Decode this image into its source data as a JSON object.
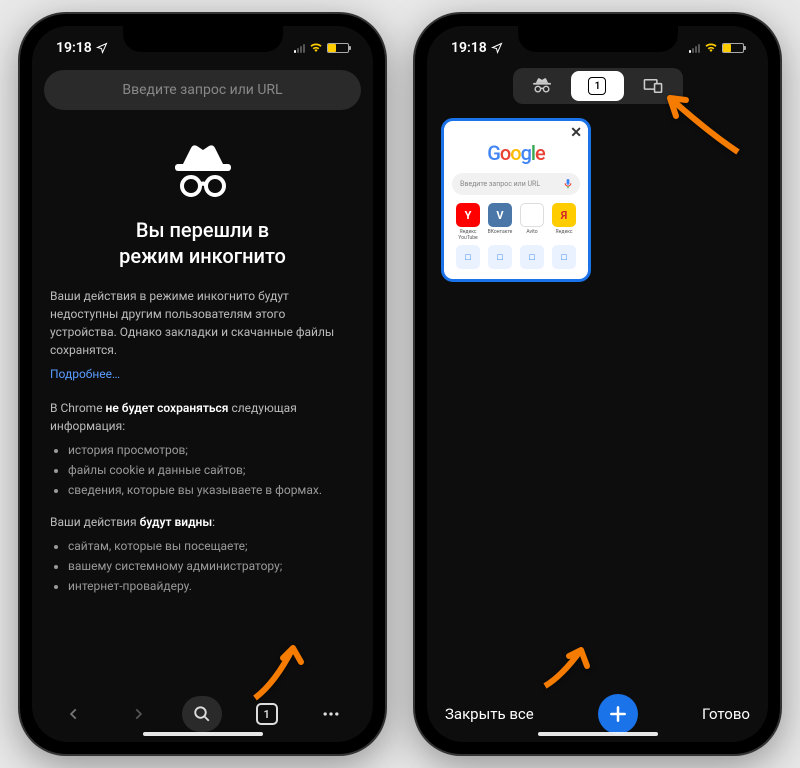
{
  "status": {
    "time": "19:18",
    "battery_level_pct": 40
  },
  "phone1": {
    "omnibox_placeholder": "Введите запрос или URL",
    "hero_title_l1": "Вы перешли в",
    "hero_title_l2": "режим инкогнито",
    "desc": "Ваши действия в режиме инкогнито будут недоступны другим пользователям этого устройства. Однако закладки и скачанные файлы сохранятся.",
    "more_link": "Подробнее…",
    "not_saved_prefix": "В Chrome ",
    "not_saved_bold": "не будет сохраняться",
    "not_saved_suffix": " следующая информация:",
    "not_saved_items": [
      "история просмотров;",
      "файлы cookie и данные сайтов;",
      "сведения, которые вы указываете в формах."
    ],
    "visible_prefix": "Ваши действия ",
    "visible_bold": "будут видны",
    "visible_suffix": ":",
    "visible_items": [
      "сайтам, которые вы посещаете;",
      "вашему системному администратору;",
      "интернет-провайдеру."
    ],
    "tab_count": "1"
  },
  "phone2": {
    "seg_tab_count": "1",
    "tab_card": {
      "search_placeholder": "Введите запрос или URL",
      "tiles": [
        {
          "label": "Яндекс YouTube",
          "bg": "#ff0000",
          "text": "Y"
        },
        {
          "label": "ВКонтакте",
          "bg": "#4a76a8",
          "text": "V"
        },
        {
          "label": "Avito",
          "bg": "#ffffff",
          "text": "",
          "border": "1px solid #ddd"
        },
        {
          "label": "Яндекс",
          "bg": "#ffcc00",
          "text": "Я",
          "color": "#d62828"
        }
      ]
    },
    "footer": {
      "close_all": "Закрыть все",
      "done": "Готово"
    }
  },
  "colors": {
    "accent": "#1a73e8",
    "annotation_arrow": "#f57c00"
  }
}
